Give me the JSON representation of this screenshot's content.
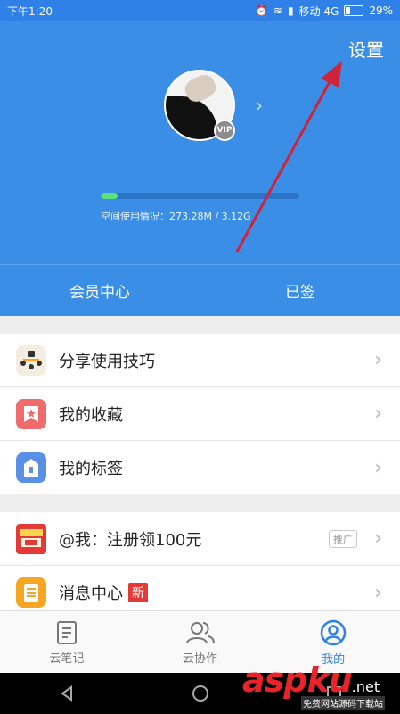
{
  "status_bar": {
    "time": "下午1:20",
    "carrier": "移动 4G",
    "battery": "29%",
    "battery_level": 0.29
  },
  "header": {
    "settings_label": "设置",
    "vip_label": "VIP",
    "storage_text": "空间使用情况：273.28M / 3.12G",
    "storage_used_fraction": 0.085
  },
  "actions": {
    "member_center": "会员中心",
    "signed": "已签"
  },
  "section1": {
    "items": [
      {
        "label": "分享使用技巧",
        "icon": "share-tips-icon",
        "color": "#f3eee0"
      },
      {
        "label": "我的收藏",
        "icon": "favorites-icon",
        "color": "#f06b6b"
      },
      {
        "label": "我的标签",
        "icon": "tag-icon",
        "color": "#5a8fe6"
      }
    ]
  },
  "section2": {
    "items": [
      {
        "label": "@我：注册领100元",
        "icon": "promo-icon",
        "promo_tag": "推广"
      },
      {
        "label": "消息中心",
        "icon": "message-icon",
        "badge": "新",
        "color": "#f5a623"
      }
    ]
  },
  "bottom_nav": {
    "tabs": [
      {
        "label": "云笔记",
        "icon": "note-icon"
      },
      {
        "label": "云协作",
        "icon": "collab-icon"
      },
      {
        "label": "我的",
        "icon": "profile-icon",
        "active": true
      }
    ]
  },
  "watermark": {
    "brand": "aspku",
    "suffix": ".net",
    "tagline": "免费网站源码下载站"
  },
  "colors": {
    "primary": "#3a8ee6",
    "accent_green": "#5ee07a",
    "arrow_red": "#d0233a"
  }
}
